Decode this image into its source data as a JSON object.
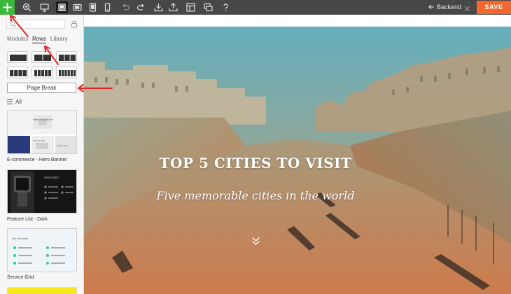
{
  "toolbar": {
    "back_label": "Backend",
    "save_label": "SAVE",
    "icons": [
      "plus-icon",
      "zoom-icon",
      "desktop-icon",
      "laptop-icon",
      "tablet-landscape-icon",
      "tablet-icon",
      "mobile-icon",
      "undo-icon",
      "redo-icon",
      "download-icon",
      "upload-icon",
      "layout-icon",
      "windows-icon",
      "help-icon",
      "arrow-left-icon",
      "close-icon"
    ]
  },
  "sidebar": {
    "search_placeholder": "",
    "tabs": [
      "Modules",
      "Rows",
      "Library"
    ],
    "active_tab": "Rows",
    "page_break_label": "Page Break",
    "filter_label": "All",
    "templates": [
      {
        "label": "E-commerce - Hero Banner",
        "thumb_heading": "New Collections",
        "thumb_cards": [
          "Special Offer",
          "Lovely Sofa"
        ]
      },
      {
        "label": "Feature List - Dark",
        "thumb_heading": "FEATURES"
      },
      {
        "label": "Service Grid",
        "thumb_heading": "Our Services"
      }
    ]
  },
  "hero": {
    "title": "TOP 5 CITIES TO VISIT",
    "subtitle": "Five memorable cities in the world"
  },
  "colors": {
    "toolbar_bg": "#474747",
    "add_button": "#3bb83b",
    "save_button": "#f4672c",
    "annotation": "#e8262a",
    "hero_top": "#62aab8",
    "hero_bottom": "#dd8653"
  }
}
